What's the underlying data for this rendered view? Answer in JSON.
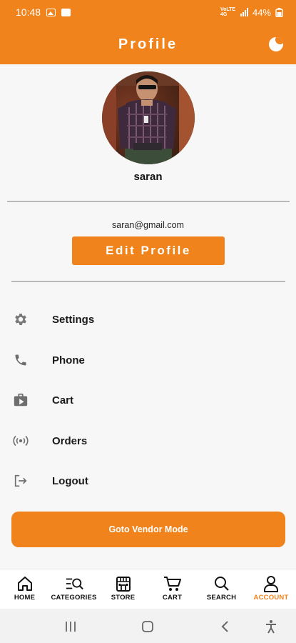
{
  "status_bar": {
    "time": "10:48",
    "network": "VoLTE 4G",
    "battery": "44%"
  },
  "header": {
    "title": "Profile",
    "theme_toggle_icon": "moon-icon"
  },
  "profile": {
    "name": "saran",
    "email": "saran@gmail.com",
    "edit_label": "Edit Profile"
  },
  "menu": {
    "items": [
      {
        "label": "Settings",
        "icon": "gear-icon"
      },
      {
        "label": "Phone",
        "icon": "phone-icon"
      },
      {
        "label": "Cart",
        "icon": "shopping-bag-icon"
      },
      {
        "label": "Orders",
        "icon": "broadcast-icon"
      },
      {
        "label": "Logout",
        "icon": "logout-icon"
      }
    ]
  },
  "vendor_button": {
    "label": "Goto Vendor Mode"
  },
  "bottom_nav": {
    "items": [
      {
        "label": "HOME",
        "icon": "home-icon",
        "active": false
      },
      {
        "label": "CATEGORIES",
        "icon": "categories-icon",
        "active": false
      },
      {
        "label": "STORE",
        "icon": "store-icon",
        "active": false
      },
      {
        "label": "CART",
        "icon": "cart-icon",
        "active": false
      },
      {
        "label": "SEARCH",
        "icon": "search-icon",
        "active": false
      },
      {
        "label": "ACCOUNT",
        "icon": "account-icon",
        "active": true
      }
    ]
  },
  "colors": {
    "accent": "#f0831c",
    "background": "#f7f7f7",
    "text": "#111111"
  }
}
